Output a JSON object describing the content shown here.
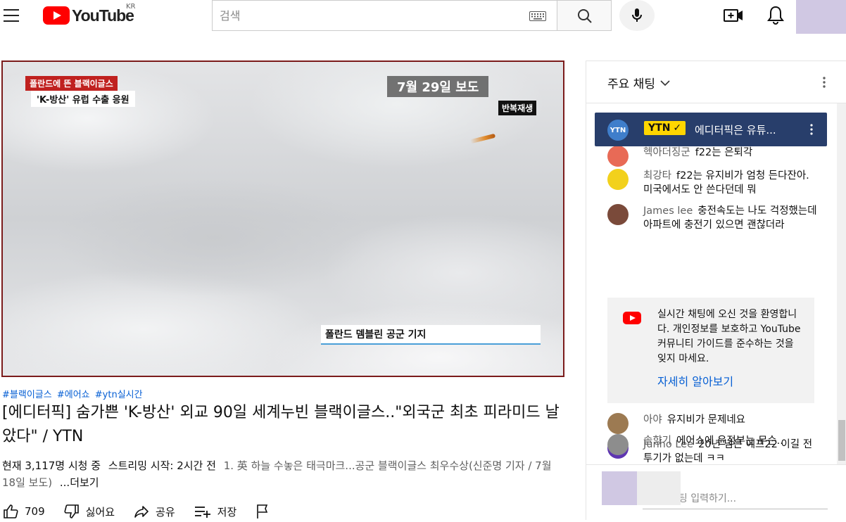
{
  "header": {
    "logo_text": "YouTube",
    "region": "KR",
    "search_placeholder": "검색"
  },
  "video": {
    "overlay_tag_red": "폴란드에 뜬 블랙이글스",
    "overlay_tag_white": "'K-방산' 유럽 수출 응원",
    "overlay_date": "7월 29일 보도",
    "overlay_replay": "반복재생",
    "overlay_location": "폴란드 뎀블린 공군 기지",
    "hashtags": [
      "#블랙이글스",
      "#에어쇼",
      "#ytn실시간"
    ],
    "title": "[에디터픽] 숨가쁜 'K-방산' 외교 90일 세계누빈 블랙이글스..\"외국군 최초 피라미드 날았다\" / YTN",
    "viewers": "현재 3,117명 시청 중",
    "stream_start": "스트리밍 시작: 2시간 전",
    "description": "1. 英 하늘 수놓은 태극마크...공군 블랙이글스 최우수상(신준명 기자 / 7월 18일 보도)",
    "more_label": "...더보기",
    "like_count": "709",
    "dislike_label": "싫어요",
    "share_label": "공유",
    "save_label": "저장"
  },
  "chat": {
    "mode_label": "주요 채팅",
    "pinned": {
      "avatar_text": "YTN",
      "owner": "YTN",
      "message": "에디터픽은 유튜..."
    },
    "messages": [
      {
        "author": "헥아더징군",
        "text": "f22는 은퇴각",
        "avatar_color": "#e86a56"
      },
      {
        "author": "최강타",
        "text": "f22는 유지비가 엄청 든다잔아. 미국에서도 안 쓴다던데 뭐",
        "avatar_color": "#f2d11c"
      },
      {
        "author": "James lee",
        "text": "충전속도는 나도 걱정했는데 아파트에 충전기 있으면 괜찮더라",
        "avatar_color": "#7a4a3a"
      },
      {
        "author": "아야",
        "text": "유지비가 문제네요",
        "avatar_color": "#9c7a52"
      },
      {
        "author": "Junho Lee",
        "text": "20년 넘은 에프22 이길 전투기가 없는데 ㅋㅋ",
        "avatar_color": "#5e35b1",
        "avatar_letter": "J"
      },
      {
        "author": "솔향기",
        "text": "에어쇼에 윤정부는 무슨..",
        "avatar_color": "#8d8d8d"
      }
    ],
    "welcome_text": "실시간 채팅에 오신 것을 환영합니다. 개인정보를 보호하고 YouTube 커뮤니티 가이드를 준수하는 것을 잊지 마세요.",
    "learn_more": "자세히 알아보기",
    "input_placeholder": "채팅 입력하기..."
  }
}
